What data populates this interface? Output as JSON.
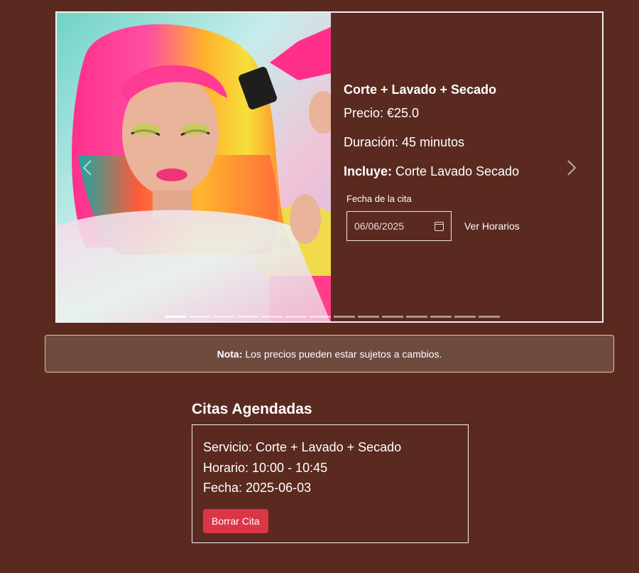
{
  "carousel": {
    "service": {
      "title": "Corte + Lavado + Secado",
      "price_label": "Precio: €25.0",
      "duration_label": "Duración: 45 minutos",
      "includes_heading": "Incluye:",
      "includes_text": "Corte Lavado Secado"
    },
    "date_field": {
      "label": "Fecha de la cita",
      "value": "06/06/2025",
      "icon": "calendar-icon"
    },
    "view_schedule_label": "Ver Horarios",
    "indicator_count": 14,
    "active_indicator": 1
  },
  "note": {
    "bold": "Nota:",
    "text": "Los precios pueden estar sujetos a cambios."
  },
  "appointments": {
    "title": "Citas Agendadas",
    "items": [
      {
        "service": "Servicio: Corte + Lavado + Secado",
        "schedule": "Horario: 10:00 - 10:45",
        "date": "Fecha: 2025-06-03",
        "delete_label": "Borrar Cita"
      }
    ]
  },
  "colors": {
    "background": "#5a2a20",
    "note_background": "#6e4a3f",
    "note_border": "#e6c98a",
    "delete_button": "#dc3545"
  }
}
